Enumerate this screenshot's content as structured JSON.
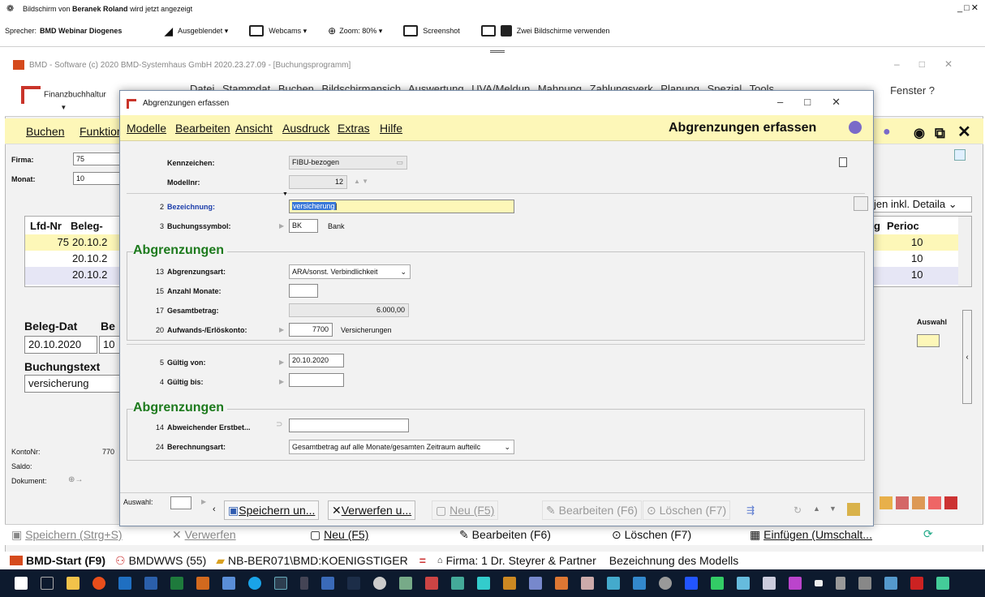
{
  "share": {
    "notice_prefix": "Bildschirm von ",
    "presenter": "Beranek Roland",
    "notice_suffix": " wird jetzt angezeigt",
    "speaker_label": "Sprecher:",
    "speaker_name": "BMD Webinar Diogenes",
    "hidden_label": "Ausgeblendet",
    "webcams_label": "Webcams",
    "zoom_label": "Zoom: 80%",
    "screenshot_label": "Screenshot",
    "two_screens_label": "Zwei Bildschirme verwenden"
  },
  "bg": {
    "title": "BMD - Software   (c) 2020 BMD-Systemhaus GmbH 2020.23.27.09 - [Buchungsprogramm]",
    "ribbon_app": "Finanzbuchhaltur",
    "ribbon_menu": "Datei  Stammdat  Buchen  Bildschirmansich  Auswertung  UVA/Meldun  Mahnung  Zahlungsverk  Planung  Spezial  Tools",
    "ribbon_fenster": "Fenster ?",
    "menu_buchen": "Buchen",
    "menu_funktion": "Funktion",
    "firma_label": "Firma:",
    "firma_value": "75",
    "monat_label": "Monat:",
    "monat_value": "10",
    "col_lfd": "Lfd-Nr",
    "col_beleg": "Beleg-",
    "rows": [
      {
        "lfd": "75",
        "beleg": "20.10.2"
      },
      {
        "lfd": "",
        "beleg": "20.10.2"
      },
      {
        "lfd": "",
        "beleg": "20.10.2"
      }
    ],
    "right_header_a": "g",
    "right_header_b": "Perioc",
    "right_rows": [
      "10",
      "10",
      "10"
    ],
    "detail_dropdown": "jen inkl. Detaila",
    "belegdat_label": "Beleg-Dat",
    "be_label": "Be",
    "belegdat_value": "20.10.2020",
    "be_value": "10",
    "buchungstext_label": "Buchungstext",
    "buchungstext_value": "versicherung",
    "auswahl_right": "Auswahl",
    "kontonr_label": "KontoNr:",
    "kontonr_value": "770",
    "saldo_label": "Saldo:",
    "dokument_label": "Dokument:",
    "footer": {
      "speichern": "Speichern (Strg+S)",
      "verwerfen": "Verwerfen",
      "neu": "Neu (F5)",
      "bearbeiten": "Bearbeiten (F6)",
      "loeschen": "Löschen (F7)",
      "einfuegen": "Einfügen (Umschalt..."
    }
  },
  "taskbar": {
    "start": "BMD-Start (F9)",
    "bmdwws": "BMDWWS (55)",
    "path": "NB-BER071\\BMD:KOENIGSTIGER",
    "firma": "Firma: 1 Dr. Steyrer & Partner",
    "model": "Bezeichnung des Modells"
  },
  "dialog": {
    "title": "Abgrenzungen erfassen",
    "menu": [
      "Modelle",
      "Bearbeiten",
      "Ansicht",
      "Ausdruck",
      "Extras",
      "Hilfe"
    ],
    "header_title": "Abgrenzungen erfassen",
    "kennzeichen_label": "Kennzeichen:",
    "kennzeichen_value": "FIBU-bezogen",
    "modellnr_label": "Modellnr:",
    "modellnr_value": "12",
    "f2_num": "2",
    "bezeichnung_label": "Bezeichnung:",
    "bezeichnung_value": "versicherung",
    "f3_num": "3",
    "buchungssymbol_label": "Buchungssymbol:",
    "buchungssymbol_value": "BK",
    "buchungssymbol_text": "Bank",
    "section1": "Abgrenzungen",
    "f13_num": "13",
    "abgrenzungsart_label": "Abgrenzungsart:",
    "abgrenzungsart_value": "ARA/sonst. Verbindlichkeit",
    "f15_num": "15",
    "anzahl_label": "Anzahl Monate:",
    "anzahl_value": "",
    "f17_num": "17",
    "gesamt_label": "Gesamtbetrag:",
    "gesamt_value": "6.000,00",
    "f20_num": "20",
    "aufwand_label": "Aufwands-/Erlöskonto:",
    "aufwand_value": "7700",
    "aufwand_text": "Versicherungen",
    "f5_num": "5",
    "gueltig_von_label": "Gültig von:",
    "gueltig_von_value": "20.10.2020",
    "f4_num": "4",
    "gueltig_bis_label": "Gültig bis:",
    "gueltig_bis_value": "",
    "section2": "Abgrenzungen",
    "f14_num": "14",
    "abweichender_label": "Abweichender Erstbet...",
    "abweichender_value": "",
    "f24_num": "24",
    "berechnungsart_label": "Berechnungsart:",
    "berechnungsart_value": "Gesamtbetrag auf alle Monate/gesamten Zeitraum aufteilc",
    "footer": {
      "auswahl_label": "Auswahl:",
      "speichern": "Speichern un...",
      "verwerfen": "Verwerfen u...",
      "neu": "Neu (F5)",
      "bearbeiten": "Bearbeiten (F6)",
      "loeschen": "Löschen (F7)"
    }
  }
}
